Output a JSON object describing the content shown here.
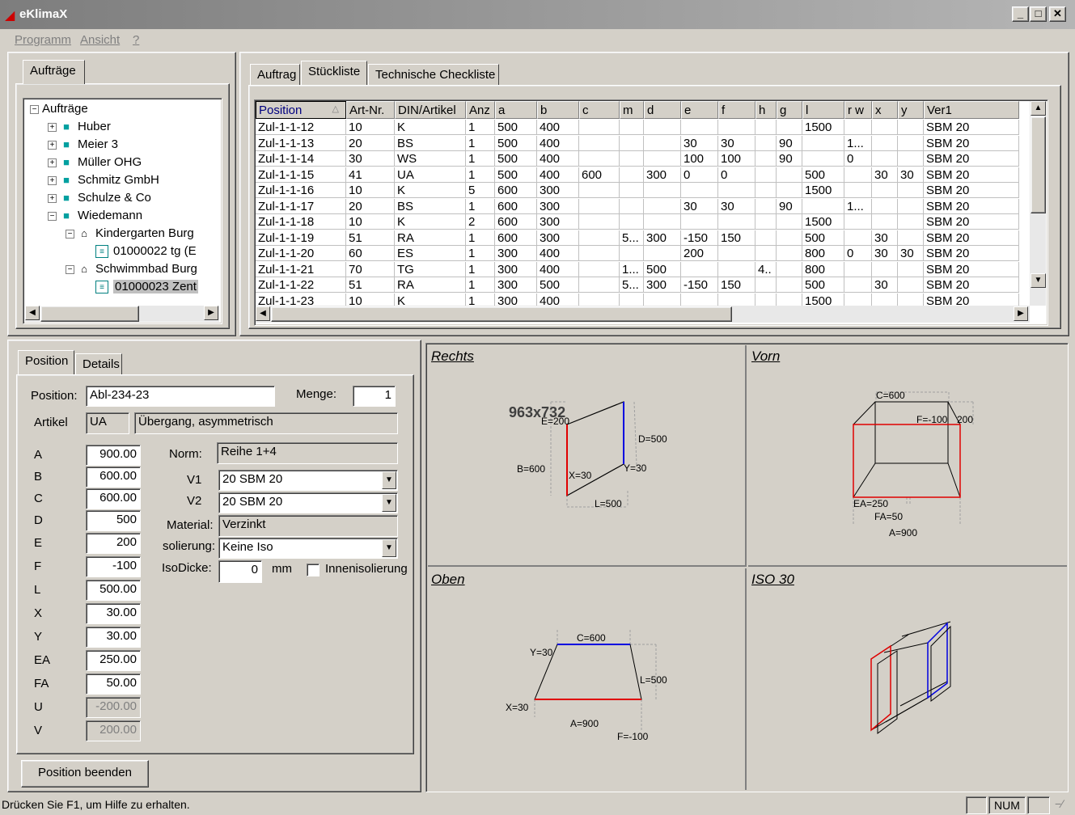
{
  "window": {
    "title": "eKlimaX"
  },
  "menu": [
    "Programm",
    "Ansicht",
    "?"
  ],
  "tree": {
    "tab": "Aufträge",
    "root": "Aufträge",
    "nodes": [
      {
        "label": "Huber",
        "level": 1,
        "exp": "+"
      },
      {
        "label": "Meier 3",
        "level": 1,
        "exp": "+"
      },
      {
        "label": "Müller OHG",
        "level": 1,
        "exp": "+"
      },
      {
        "label": "Schmitz GmbH",
        "level": 1,
        "exp": "+"
      },
      {
        "label": "Schulze & Co",
        "level": 1,
        "exp": "+"
      },
      {
        "label": "Wiedemann",
        "level": 1,
        "exp": "-"
      },
      {
        "label": "Kindergarten Burg",
        "level": 2,
        "exp": "-"
      },
      {
        "label": "01000022 tg (E",
        "level": 3,
        "exp": ""
      },
      {
        "label": "Schwimmbad Burg",
        "level": 2,
        "exp": "-"
      },
      {
        "label": "01000023 Zent",
        "level": 3,
        "exp": "",
        "selected": true
      }
    ]
  },
  "main_tabs": [
    "Auftrag",
    "Stückliste",
    "Technische Checkliste"
  ],
  "grid": {
    "columns": [
      "Position",
      "Art-Nr.",
      "DIN/Artikel",
      "Anz",
      "a",
      "b",
      "c",
      "m",
      "d",
      "e",
      "f",
      "h",
      "g",
      "l",
      "r w",
      "x",
      "y",
      "Ver1"
    ],
    "rows": [
      [
        "Zul-1-1-12",
        "10",
        "K",
        "1",
        "500",
        "400",
        "",
        "",
        "",
        "",
        "",
        "",
        "",
        "1500",
        "",
        "",
        "",
        "SBM 20"
      ],
      [
        "Zul-1-1-13",
        "20",
        "BS",
        "1",
        "500",
        "400",
        "",
        "",
        "",
        "30",
        "30",
        "",
        "90",
        "",
        "1...",
        "",
        "",
        "SBM 20"
      ],
      [
        "Zul-1-1-14",
        "30",
        "WS",
        "1",
        "500",
        "400",
        "",
        "",
        "",
        "100",
        "100",
        "",
        "90",
        "",
        "0",
        "",
        "",
        "SBM 20"
      ],
      [
        "Zul-1-1-15",
        "41",
        "UA",
        "1",
        "500",
        "400",
        "600",
        "",
        "300",
        "0",
        "0",
        "",
        "",
        "500",
        "",
        "30",
        "30",
        "SBM 20"
      ],
      [
        "Zul-1-1-16",
        "10",
        "K",
        "5",
        "600",
        "300",
        "",
        "",
        "",
        "",
        "",
        "",
        "",
        "1500",
        "",
        "",
        "",
        "SBM 20"
      ],
      [
        "Zul-1-1-17",
        "20",
        "BS",
        "1",
        "600",
        "300",
        "",
        "",
        "",
        "30",
        "30",
        "",
        "90",
        "",
        "1...",
        "",
        "",
        "SBM 20"
      ],
      [
        "Zul-1-1-18",
        "10",
        "K",
        "2",
        "600",
        "300",
        "",
        "",
        "",
        "",
        "",
        "",
        "",
        "1500",
        "",
        "",
        "",
        "SBM 20"
      ],
      [
        "Zul-1-1-19",
        "51",
        "RA",
        "1",
        "600",
        "300",
        "",
        "5...",
        "300",
        "-150",
        "150",
        "",
        "",
        "500",
        "",
        "30",
        "",
        "SBM 20"
      ],
      [
        "Zul-1-1-20",
        "60",
        "ES",
        "1",
        "300",
        "400",
        "",
        "",
        "",
        "200",
        "",
        "",
        "",
        "800",
        "0",
        "30",
        "30",
        "SBM 20"
      ],
      [
        "Zul-1-1-21",
        "70",
        "TG",
        "1",
        "300",
        "400",
        "",
        "1...",
        "500",
        "",
        "",
        "4..",
        "",
        "800",
        "",
        "",
        "",
        "SBM 20"
      ],
      [
        "Zul-1-1-22",
        "51",
        "RA",
        "1",
        "300",
        "500",
        "",
        "5...",
        "300",
        "-150",
        "150",
        "",
        "",
        "500",
        "",
        "30",
        "",
        "SBM 20"
      ],
      [
        "Zul-1-1-23",
        "10",
        "K",
        "1",
        "300",
        "400",
        "",
        "",
        "",
        "",
        "",
        "",
        "",
        "1500",
        "",
        "",
        "",
        "SBM 20"
      ]
    ]
  },
  "detail": {
    "tabs": [
      "Position",
      "Details"
    ],
    "position_label": "Position:",
    "position_value": "Abl-234-23",
    "menge_label": "Menge:",
    "menge_value": "1",
    "artikel_label": "Artikel",
    "artikel_code": "UA",
    "artikel_name": "Übergang, asymmetrisch",
    "params": [
      {
        "label": "A",
        "value": "900.00"
      },
      {
        "label": "B",
        "value": "600.00"
      },
      {
        "label": "C",
        "value": "600.00"
      },
      {
        "label": "D",
        "value": "500"
      },
      {
        "label": "E",
        "value": "200"
      },
      {
        "label": "F",
        "value": "-100"
      },
      {
        "label": "L",
        "value": "500.00"
      },
      {
        "label": "X",
        "value": "30.00"
      },
      {
        "label": "Y",
        "value": "30.00"
      },
      {
        "label": "EA",
        "value": "250.00"
      },
      {
        "label": "FA",
        "value": "50.00"
      },
      {
        "label": "U",
        "value": "-200.00",
        "disabled": true
      },
      {
        "label": "V",
        "value": "200.00",
        "disabled": true
      }
    ],
    "norm_label": "Norm:",
    "norm_value": "Reihe 1+4",
    "v1_label": "V1",
    "v1_value": "20 SBM 20",
    "v2_label": "V2",
    "v2_value": "20 SBM 20",
    "material_label": "Material:",
    "material_value": "Verzinkt",
    "iso_label": "solierung:",
    "iso_value": "Keine Iso",
    "isodicke_label": "IsoDicke:",
    "isodicke_value": "0",
    "mm": "mm",
    "innen_label": "Innenisolierung",
    "finish_button": "Position beenden"
  },
  "views": {
    "rechts": {
      "title": "Rechts",
      "overlay": "963x732",
      "labels": {
        "e": "E=200",
        "d": "D=500",
        "b": "B=600",
        "x": "X=30",
        "y": "Y=30",
        "l": "L=500"
      }
    },
    "vorn": {
      "title": "Vorn",
      "labels": {
        "c": "C=600",
        "f": "F=-100",
        "f2": "200",
        "ea": "EA=250",
        "fa": "FA=50",
        "a": "A=900"
      }
    },
    "oben": {
      "title": "Oben",
      "labels": {
        "c": "C=600",
        "y": "Y=30",
        "l": "L=500",
        "x": "X=30",
        "a": "A=900",
        "f": "F=-100"
      }
    },
    "iso": {
      "title": "ISO 30"
    }
  },
  "status": {
    "text": "Drücken Sie F1, um Hilfe zu erhalten.",
    "num": "NUM"
  },
  "colors": {
    "red": "#e00000",
    "blue": "#0000e0"
  }
}
